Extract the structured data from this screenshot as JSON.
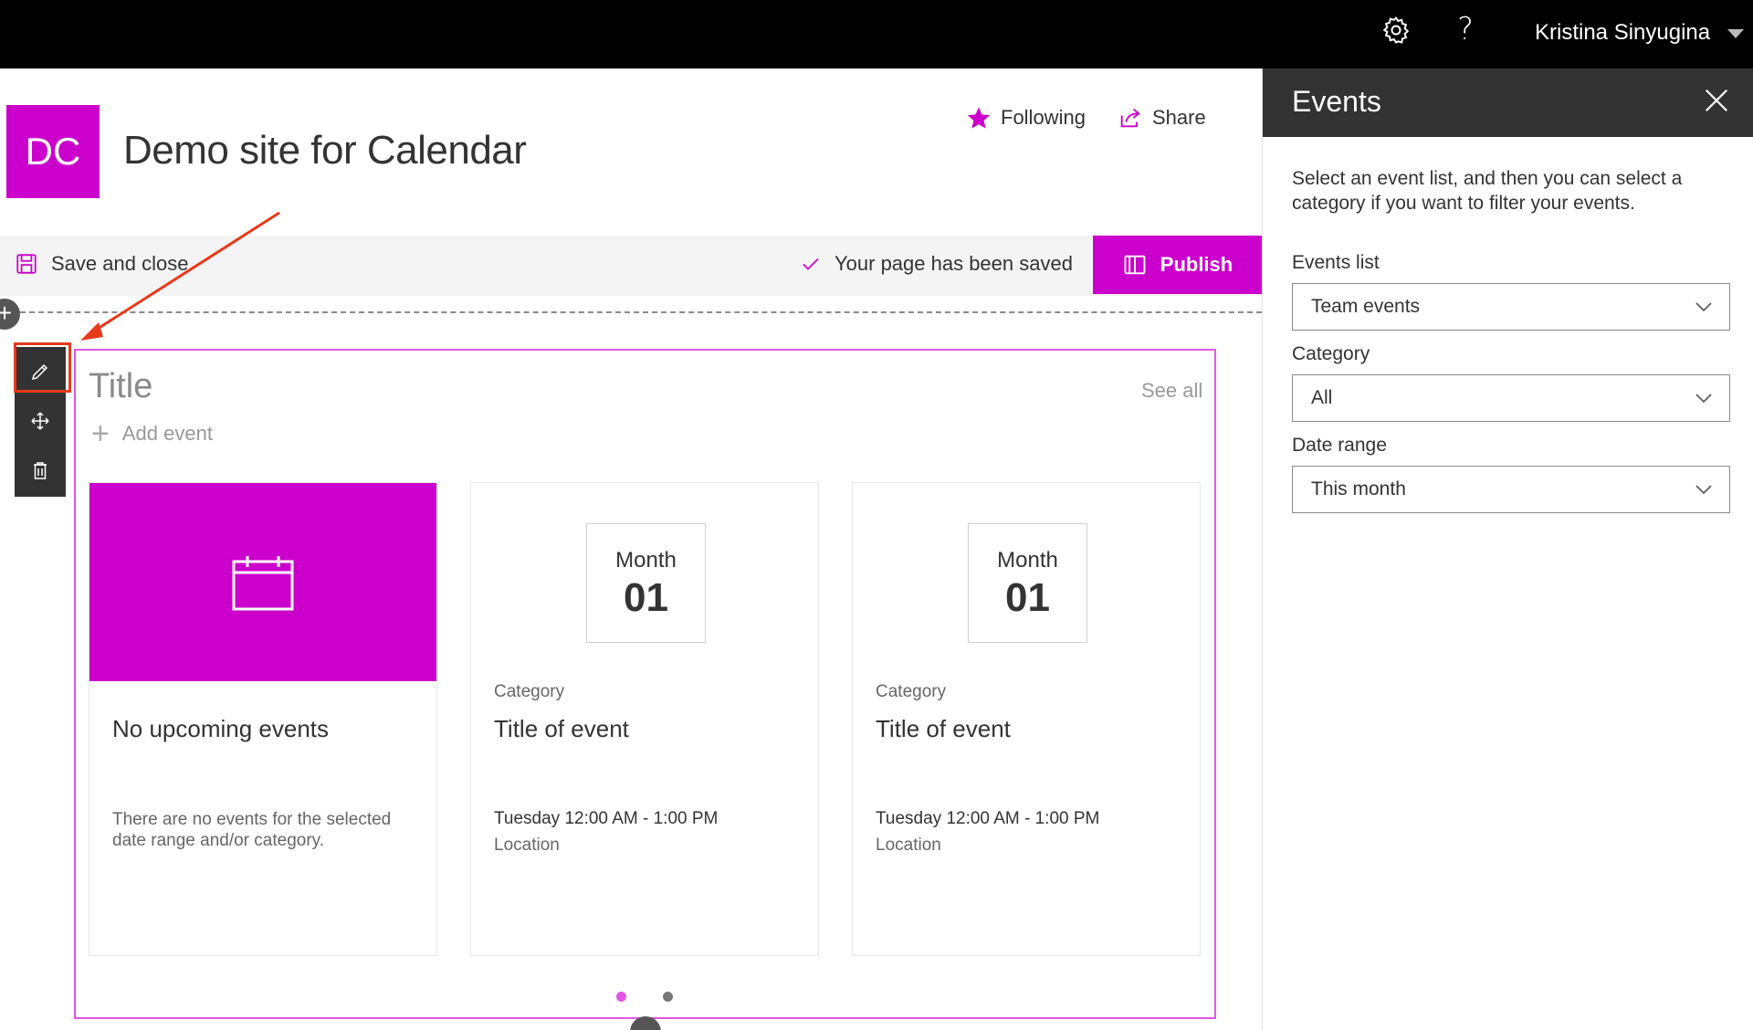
{
  "suite": {
    "user_name": "Kristina Sinyugina",
    "help_label": "?"
  },
  "site": {
    "logo_initials": "DC",
    "title": "Demo site for Calendar",
    "following_label": "Following",
    "share_label": "Share"
  },
  "commandbar": {
    "save_close_label": "Save and close",
    "status_text": "Your page has been saved",
    "publish_label": "Publish"
  },
  "webpart": {
    "title": "Title",
    "see_all": "See all",
    "add_event": "Add event",
    "empty_card": {
      "heading": "No upcoming events",
      "description": "There are no events for the selected date range and/or category."
    },
    "events": [
      {
        "month": "Month",
        "day": "01",
        "category": "Category",
        "title": "Title of event",
        "time": "Tuesday 12:00 AM - 1:00 PM",
        "location": "Location"
      },
      {
        "month": "Month",
        "day": "01",
        "category": "Category",
        "title": "Title of event",
        "time": "Tuesday 12:00 AM - 1:00 PM",
        "location": "Location"
      }
    ],
    "pagination": {
      "pages": 2,
      "active": 1
    }
  },
  "panel": {
    "title": "Events",
    "description": "Select an event list, and then you can select a category if you want to filter your events.",
    "events_list_label": "Events list",
    "events_list_value": "Team events",
    "category_label": "Category",
    "category_value": "All",
    "date_range_label": "Date range",
    "date_range_value": "This month"
  },
  "colors": {
    "brand": "#cc00cc",
    "suitebar": "#000000",
    "panel_header": "#333333",
    "annotation": "#e63a1a"
  },
  "icons": [
    "gear-icon",
    "help-icon",
    "caret-down-icon",
    "star-icon",
    "share-icon",
    "save-icon",
    "checkmark-icon",
    "publish-book-icon",
    "edit-pencil-icon",
    "move-icon",
    "delete-trash-icon",
    "plus-icon",
    "calendar-icon",
    "close-icon",
    "chevron-down-icon"
  ]
}
